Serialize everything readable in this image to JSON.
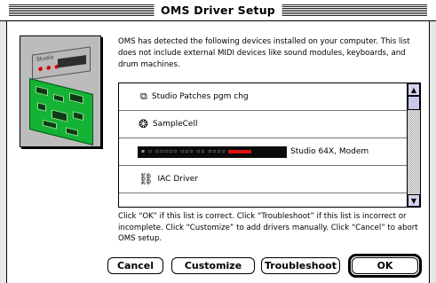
{
  "window": {
    "title": "OMS Driver Setup"
  },
  "illustration": {
    "device_label": "Studio"
  },
  "description": "OMS has detected the following devices installed on your computer. This list does not include external MIDI devices like sound modules, keyboards, and drum machines.",
  "devices": [
    {
      "label": "Studio Patches pgm chg",
      "icon": "patch-icon"
    },
    {
      "label": "SampleCell",
      "icon": "samplecell-icon"
    },
    {
      "label": "Studio 64X, Modem",
      "icon": "studio-64x-rack-icon"
    },
    {
      "label": "IAC Driver",
      "icon": "iac-driver-icon"
    }
  ],
  "instructions": "Click “OK” if this list is correct. Click “Troubleshoot” if this list is incorrect or incomplete. Click “Customize” to add drivers manually. Click “Cancel” to abort OMS setup.",
  "buttons": {
    "cancel": "Cancel",
    "customize": "Customize",
    "troubleshoot": "Troubleshoot",
    "ok": "OK"
  },
  "colors": {
    "pcb_green": "#15b335",
    "scrollbar_arrow": "#d4d4f0"
  }
}
